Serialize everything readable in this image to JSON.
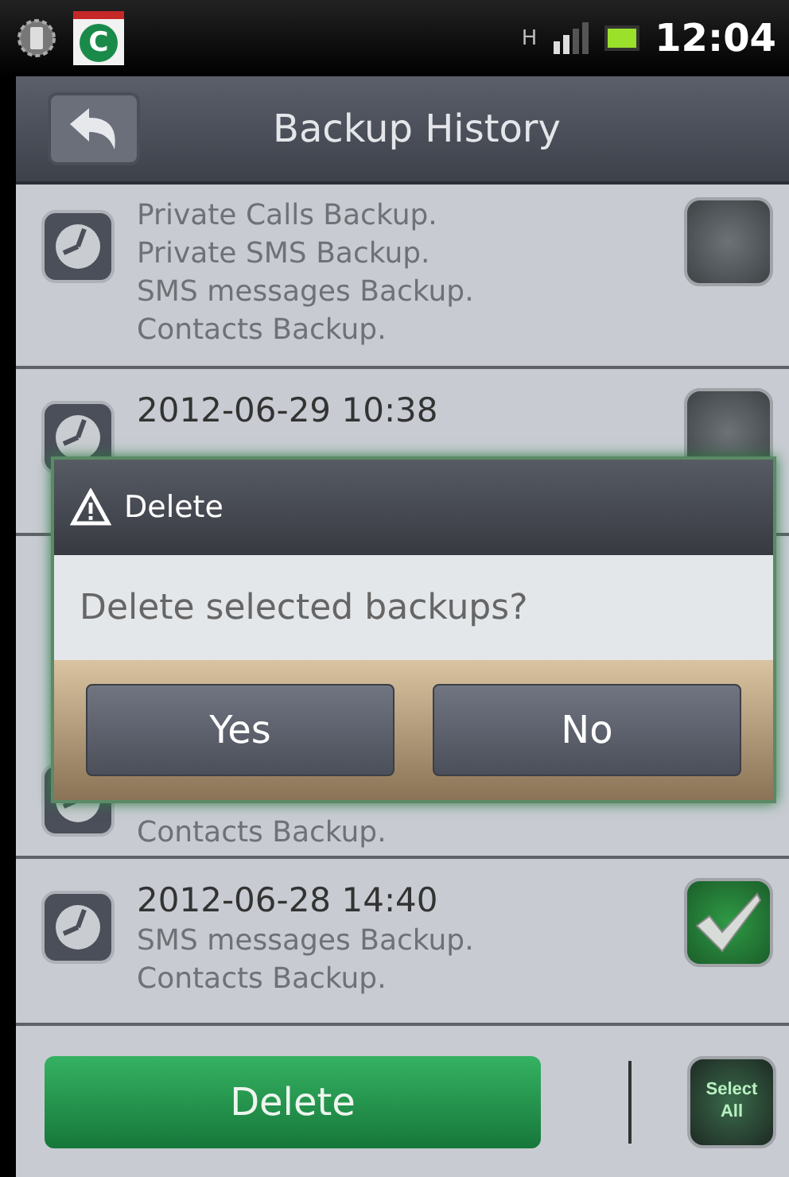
{
  "status_bar": {
    "app_icon_letter": "C",
    "network": "H",
    "time": "12:04"
  },
  "title_bar": {
    "title": "Backup History"
  },
  "backups": [
    {
      "lines": [
        "Private Calls Backup.",
        "Private SMS Backup.",
        "SMS messages Backup.",
        "Contacts Backup."
      ],
      "checked": false
    },
    {
      "date": "2012-06-29 10:38",
      "checked": false
    },
    {
      "lines": [
        "Contacts Backup."
      ]
    },
    {
      "date": "2012-06-28 14:40",
      "lines": [
        "SMS messages Backup.",
        "Contacts Backup."
      ],
      "checked": true
    }
  ],
  "dialog": {
    "title": "Delete",
    "message": "Delete selected backups?",
    "buttons": [
      "Yes",
      "No"
    ]
  },
  "bottom_bar": {
    "delete_button": "Delete",
    "select_all_button": "Select All"
  }
}
